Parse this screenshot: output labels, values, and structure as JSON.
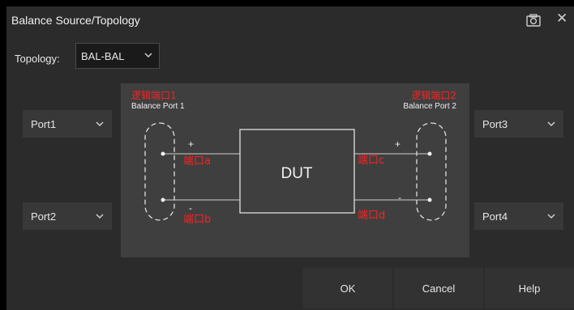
{
  "dialog": {
    "title": "Balance Source/Topology",
    "icons": {
      "screenshot": "camera-icon",
      "close": "close-icon"
    }
  },
  "topology": {
    "label": "Topology:",
    "value": "BAL-BAL"
  },
  "ports": {
    "left_top": "Port1",
    "left_bottom": "Port2",
    "right_top": "Port3",
    "right_bottom": "Port4"
  },
  "diagram": {
    "logical_port_1": "逻辑端口1",
    "balance_port_1": "Balance Port 1",
    "logical_port_2": "逻辑端口2",
    "balance_port_2": "Balance Port 2",
    "dut": "DUT",
    "port_a": "端口a",
    "port_b": "端口b",
    "port_c": "端口c",
    "port_d": "端口d",
    "plus": "+",
    "minus": "-"
  },
  "buttons": {
    "ok": "OK",
    "cancel": "Cancel",
    "help": "Help"
  },
  "colors": {
    "background": "#2b2b2b",
    "diagram_bg": "#3f3f3f",
    "annotation_red": "#ff2020",
    "button_bg": "#323232"
  }
}
